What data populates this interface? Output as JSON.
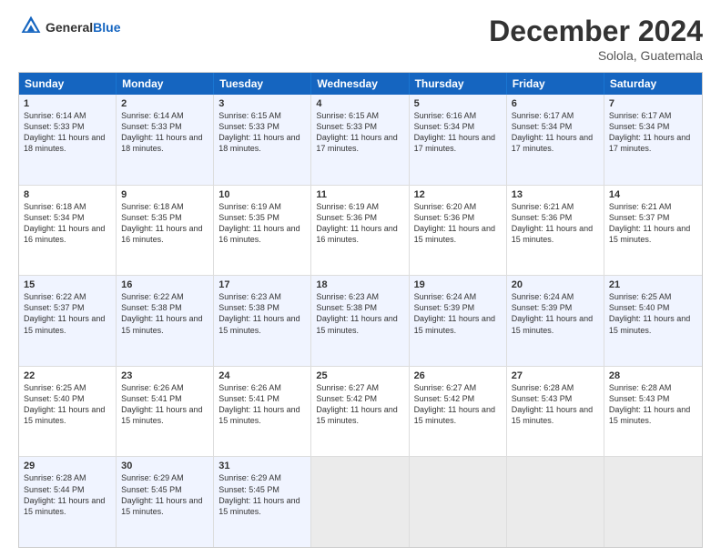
{
  "logo": {
    "general": "General",
    "blue": "Blue"
  },
  "title": "December 2024",
  "location": "Solola, Guatemala",
  "days": [
    "Sunday",
    "Monday",
    "Tuesday",
    "Wednesday",
    "Thursday",
    "Friday",
    "Saturday"
  ],
  "weeks": [
    [
      {
        "num": "1",
        "rise": "6:14 AM",
        "set": "5:33 PM",
        "daylight": "11 hours and 18 minutes."
      },
      {
        "num": "2",
        "rise": "6:14 AM",
        "set": "5:33 PM",
        "daylight": "11 hours and 18 minutes."
      },
      {
        "num": "3",
        "rise": "6:15 AM",
        "set": "5:33 PM",
        "daylight": "11 hours and 18 minutes."
      },
      {
        "num": "4",
        "rise": "6:15 AM",
        "set": "5:33 PM",
        "daylight": "11 hours and 17 minutes."
      },
      {
        "num": "5",
        "rise": "6:16 AM",
        "set": "5:34 PM",
        "daylight": "11 hours and 17 minutes."
      },
      {
        "num": "6",
        "rise": "6:17 AM",
        "set": "5:34 PM",
        "daylight": "11 hours and 17 minutes."
      },
      {
        "num": "7",
        "rise": "6:17 AM",
        "set": "5:34 PM",
        "daylight": "11 hours and 17 minutes."
      }
    ],
    [
      {
        "num": "8",
        "rise": "6:18 AM",
        "set": "5:34 PM",
        "daylight": "11 hours and 16 minutes."
      },
      {
        "num": "9",
        "rise": "6:18 AM",
        "set": "5:35 PM",
        "daylight": "11 hours and 16 minutes."
      },
      {
        "num": "10",
        "rise": "6:19 AM",
        "set": "5:35 PM",
        "daylight": "11 hours and 16 minutes."
      },
      {
        "num": "11",
        "rise": "6:19 AM",
        "set": "5:36 PM",
        "daylight": "11 hours and 16 minutes."
      },
      {
        "num": "12",
        "rise": "6:20 AM",
        "set": "5:36 PM",
        "daylight": "11 hours and 15 minutes."
      },
      {
        "num": "13",
        "rise": "6:21 AM",
        "set": "5:36 PM",
        "daylight": "11 hours and 15 minutes."
      },
      {
        "num": "14",
        "rise": "6:21 AM",
        "set": "5:37 PM",
        "daylight": "11 hours and 15 minutes."
      }
    ],
    [
      {
        "num": "15",
        "rise": "6:22 AM",
        "set": "5:37 PM",
        "daylight": "11 hours and 15 minutes."
      },
      {
        "num": "16",
        "rise": "6:22 AM",
        "set": "5:38 PM",
        "daylight": "11 hours and 15 minutes."
      },
      {
        "num": "17",
        "rise": "6:23 AM",
        "set": "5:38 PM",
        "daylight": "11 hours and 15 minutes."
      },
      {
        "num": "18",
        "rise": "6:23 AM",
        "set": "5:38 PM",
        "daylight": "11 hours and 15 minutes."
      },
      {
        "num": "19",
        "rise": "6:24 AM",
        "set": "5:39 PM",
        "daylight": "11 hours and 15 minutes."
      },
      {
        "num": "20",
        "rise": "6:24 AM",
        "set": "5:39 PM",
        "daylight": "11 hours and 15 minutes."
      },
      {
        "num": "21",
        "rise": "6:25 AM",
        "set": "5:40 PM",
        "daylight": "11 hours and 15 minutes."
      }
    ],
    [
      {
        "num": "22",
        "rise": "6:25 AM",
        "set": "5:40 PM",
        "daylight": "11 hours and 15 minutes."
      },
      {
        "num": "23",
        "rise": "6:26 AM",
        "set": "5:41 PM",
        "daylight": "11 hours and 15 minutes."
      },
      {
        "num": "24",
        "rise": "6:26 AM",
        "set": "5:41 PM",
        "daylight": "11 hours and 15 minutes."
      },
      {
        "num": "25",
        "rise": "6:27 AM",
        "set": "5:42 PM",
        "daylight": "11 hours and 15 minutes."
      },
      {
        "num": "26",
        "rise": "6:27 AM",
        "set": "5:42 PM",
        "daylight": "11 hours and 15 minutes."
      },
      {
        "num": "27",
        "rise": "6:28 AM",
        "set": "5:43 PM",
        "daylight": "11 hours and 15 minutes."
      },
      {
        "num": "28",
        "rise": "6:28 AM",
        "set": "5:43 PM",
        "daylight": "11 hours and 15 minutes."
      }
    ],
    [
      {
        "num": "29",
        "rise": "6:28 AM",
        "set": "5:44 PM",
        "daylight": "11 hours and 15 minutes."
      },
      {
        "num": "30",
        "rise": "6:29 AM",
        "set": "5:45 PM",
        "daylight": "11 hours and 15 minutes."
      },
      {
        "num": "31",
        "rise": "6:29 AM",
        "set": "5:45 PM",
        "daylight": "11 hours and 15 minutes."
      },
      null,
      null,
      null,
      null
    ]
  ]
}
